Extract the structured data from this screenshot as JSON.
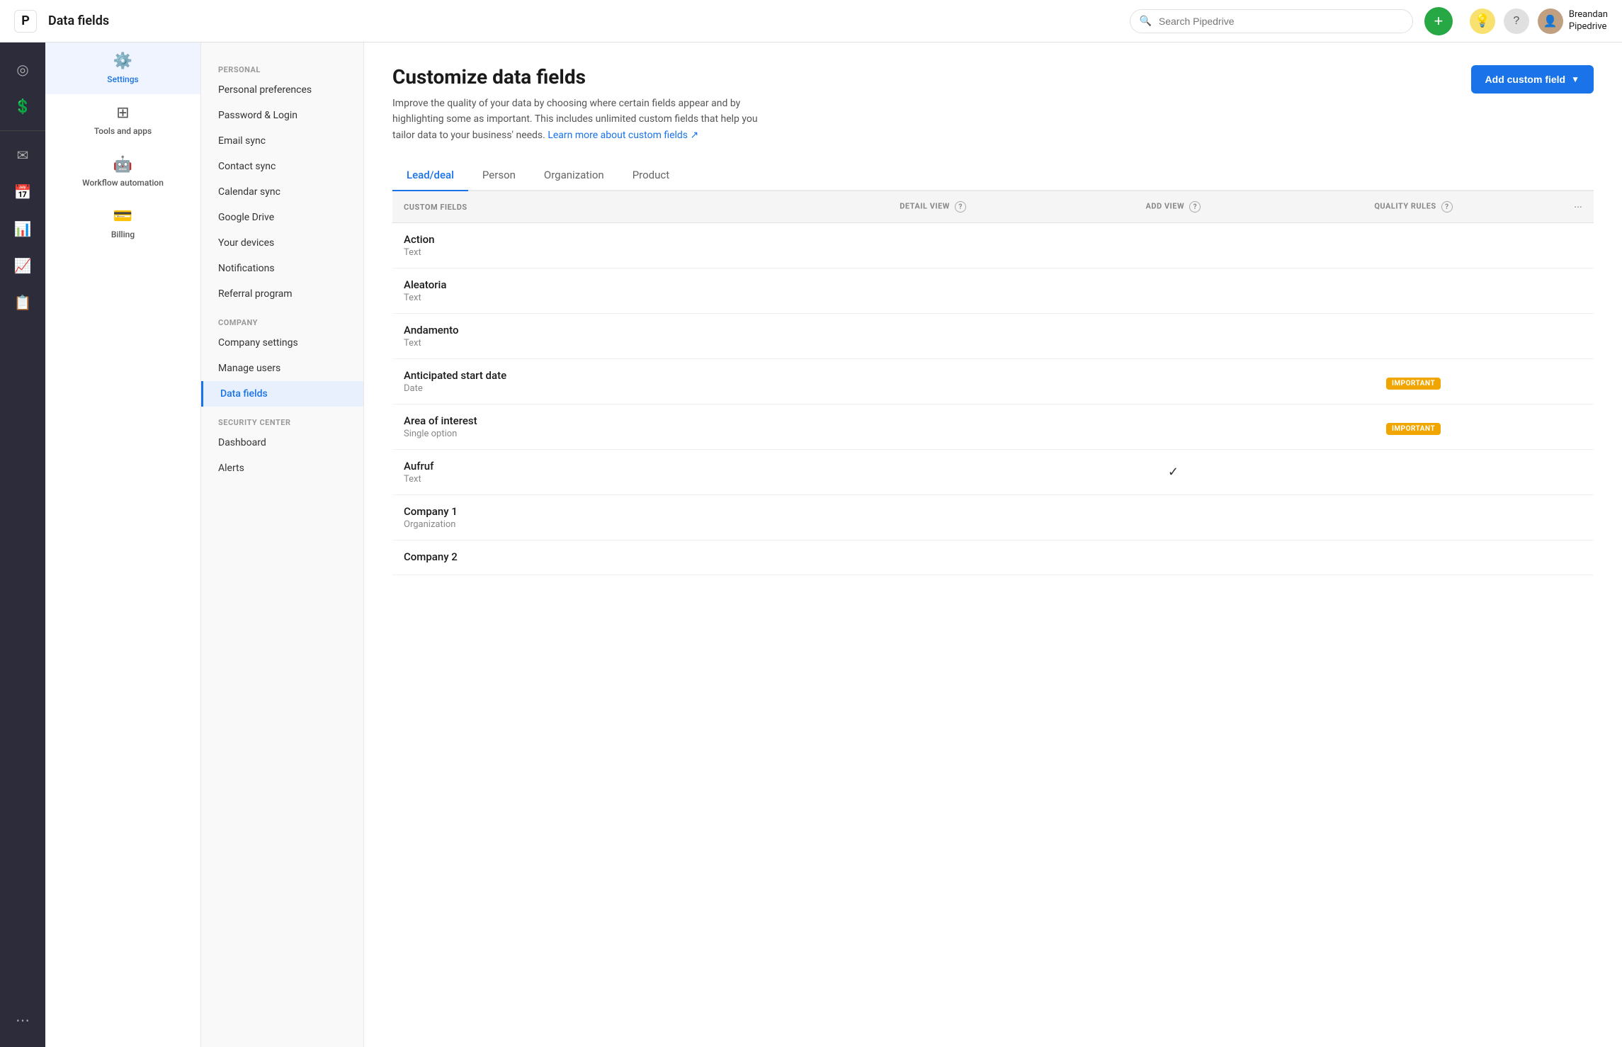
{
  "topbar": {
    "logo_text": "P",
    "title": "Data fields",
    "search_placeholder": "Search Pipedrive",
    "add_btn_label": "+",
    "bulb_icon": "💡",
    "help_icon": "?",
    "user_name": "Breandan",
    "user_company": "Pipedrive"
  },
  "icon_nav": {
    "items": [
      {
        "id": "radar",
        "icon": "◎",
        "label": ""
      },
      {
        "id": "dollar",
        "icon": "$",
        "label": ""
      },
      {
        "id": "divider",
        "icon": "—",
        "label": ""
      },
      {
        "id": "mail",
        "icon": "✉",
        "label": ""
      },
      {
        "id": "calendar",
        "icon": "▦",
        "label": ""
      },
      {
        "id": "chart",
        "icon": "▤",
        "label": ""
      },
      {
        "id": "trending",
        "icon": "↗",
        "label": ""
      },
      {
        "id": "clipboard",
        "icon": "📋",
        "label": ""
      }
    ],
    "bottom": [
      {
        "id": "dots",
        "icon": "⋯",
        "label": ""
      }
    ]
  },
  "settings_nav": [
    {
      "id": "settings",
      "icon": "⚙",
      "label": "Settings",
      "active": true
    },
    {
      "id": "tools",
      "icon": "⊞",
      "label": "Tools and apps"
    },
    {
      "id": "workflow",
      "icon": "🤖",
      "label": "Workflow automation"
    },
    {
      "id": "billing",
      "icon": "💳",
      "label": "Billing"
    }
  ],
  "left_menu": {
    "sections": [
      {
        "title": "PERSONAL",
        "items": [
          {
            "id": "personal-prefs",
            "label": "Personal preferences",
            "active": false
          },
          {
            "id": "password-login",
            "label": "Password & Login",
            "active": false
          },
          {
            "id": "email-sync",
            "label": "Email sync",
            "active": false
          },
          {
            "id": "contact-sync",
            "label": "Contact sync",
            "active": false
          },
          {
            "id": "calendar-sync",
            "label": "Calendar sync",
            "active": false
          },
          {
            "id": "google-drive",
            "label": "Google Drive",
            "active": false
          },
          {
            "id": "your-devices",
            "label": "Your devices",
            "active": false
          },
          {
            "id": "notifications",
            "label": "Notifications",
            "active": false
          },
          {
            "id": "referral-program",
            "label": "Referral program",
            "active": false
          }
        ]
      },
      {
        "title": "COMPANY",
        "items": [
          {
            "id": "company-settings",
            "label": "Company settings",
            "active": false
          },
          {
            "id": "manage-users",
            "label": "Manage users",
            "active": false
          },
          {
            "id": "data-fields",
            "label": "Data fields",
            "active": true
          }
        ]
      },
      {
        "title": "SECURITY CENTER",
        "items": [
          {
            "id": "dashboard",
            "label": "Dashboard",
            "active": false
          },
          {
            "id": "alerts",
            "label": "Alerts",
            "active": false
          }
        ]
      }
    ]
  },
  "main": {
    "title": "Customize data fields",
    "description": "Improve the quality of your data by choosing where certain fields appear and by highlighting some as important. This includes unlimited custom fields that help you tailor data to your business' needs.",
    "learn_more_link": "Learn more about custom fields ↗",
    "add_custom_field_btn": "Add custom field",
    "tabs": [
      {
        "id": "lead-deal",
        "label": "Lead/deal",
        "active": true
      },
      {
        "id": "person",
        "label": "Person",
        "active": false
      },
      {
        "id": "organization",
        "label": "Organization",
        "active": false
      },
      {
        "id": "product",
        "label": "Product",
        "active": false
      }
    ],
    "table": {
      "headers": [
        {
          "id": "custom-fields",
          "label": "CUSTOM FIELDS",
          "help": false
        },
        {
          "id": "detail-view",
          "label": "DETAIL VIEW",
          "help": true
        },
        {
          "id": "add-view",
          "label": "ADD VIEW",
          "help": true
        },
        {
          "id": "quality-rules",
          "label": "QUALITY RULES",
          "help": true
        },
        {
          "id": "more",
          "label": "···",
          "help": false
        }
      ],
      "rows": [
        {
          "id": "action",
          "name": "Action",
          "type": "Text",
          "badge": null,
          "check": false
        },
        {
          "id": "aleatoria",
          "name": "Aleatoria",
          "type": "Text",
          "badge": null,
          "check": false
        },
        {
          "id": "andamento",
          "name": "Andamento",
          "type": "Text",
          "badge": null,
          "check": false
        },
        {
          "id": "anticipated-start-date",
          "name": "Anticipated start date",
          "type": "Date",
          "badge": "IMPORTANT",
          "check": false
        },
        {
          "id": "area-of-interest",
          "name": "Area of interest",
          "type": "Single option",
          "badge": "IMPORTANT",
          "check": false
        },
        {
          "id": "aufruf",
          "name": "Aufruf",
          "type": "Text",
          "badge": null,
          "check": true
        },
        {
          "id": "company-1",
          "name": "Company 1",
          "type": "Organization",
          "badge": null,
          "check": false
        },
        {
          "id": "company-2",
          "name": "Company 2",
          "type": "",
          "badge": null,
          "check": false
        }
      ]
    }
  }
}
